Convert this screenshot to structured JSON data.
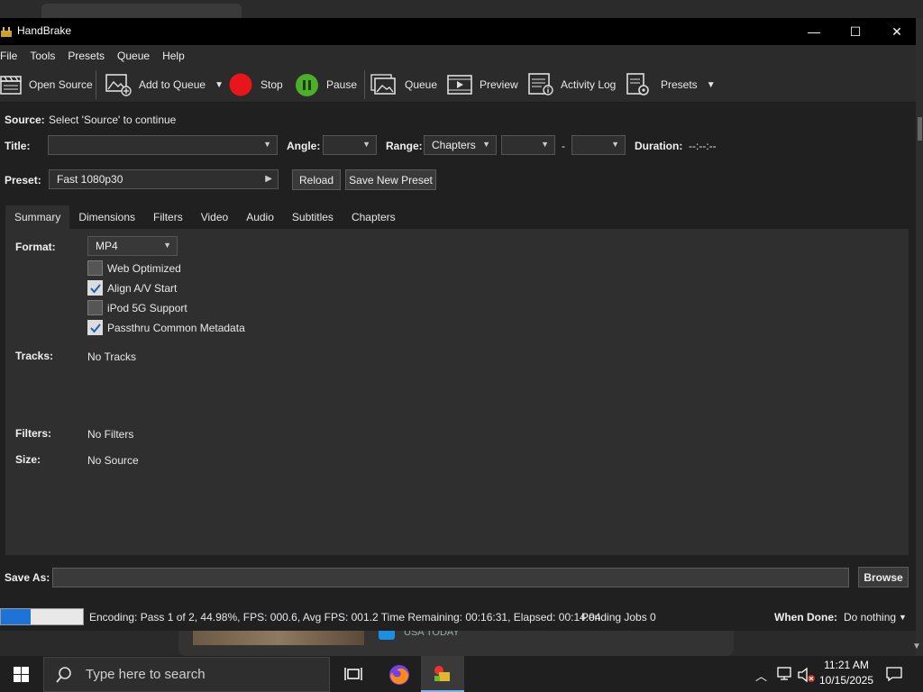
{
  "window": {
    "title": "HandBrake"
  },
  "menu": [
    "File",
    "Tools",
    "Presets",
    "Queue",
    "Help"
  ],
  "toolbar": {
    "open_source": "Open Source",
    "add_to_queue": "Add to Queue",
    "stop": "Stop",
    "pause": "Pause",
    "queue": "Queue",
    "preview": "Preview",
    "activity_log": "Activity Log",
    "presets": "Presets"
  },
  "source": {
    "label": "Source:",
    "value": "Select 'Source' to continue"
  },
  "title_row": {
    "title_label": "Title:",
    "angle_label": "Angle:",
    "range_label": "Range:",
    "range_value": "Chapters",
    "dash": "-",
    "duration_label": "Duration:",
    "duration_value": "--:--:--"
  },
  "preset_row": {
    "label": "Preset:",
    "value": "Fast 1080p30",
    "reload": "Reload",
    "save_new": "Save New Preset"
  },
  "tabs": [
    "Summary",
    "Dimensions",
    "Filters",
    "Video",
    "Audio",
    "Subtitles",
    "Chapters"
  ],
  "summary": {
    "format_label": "Format:",
    "format_value": "MP4",
    "options": [
      {
        "label": "Web Optimized",
        "checked": false
      },
      {
        "label": "Align A/V Start",
        "checked": true
      },
      {
        "label": "iPod 5G Support",
        "checked": false
      },
      {
        "label": "Passthru Common Metadata",
        "checked": true
      }
    ],
    "tracks_label": "Tracks:",
    "tracks_value": "No Tracks",
    "filters_label": "Filters:",
    "filters_value": "No Filters",
    "size_label": "Size:",
    "size_value": "No Source"
  },
  "save_as": {
    "label": "Save As:",
    "value": "",
    "browse": "Browse"
  },
  "status": {
    "progress_percent": 44.98,
    "encoding_text": "Encoding: Pass 1 of 2,  44.98%, FPS: 000.6,  Avg FPS: 001.2 Time Remaining: 00:16:31,  Elapsed: 00:14:04",
    "pending": "Pending Jobs 0",
    "when_done_label": "When Done:",
    "when_done_value": "Do nothing"
  },
  "background": {
    "card_text": "USA TODAY"
  },
  "taskbar": {
    "search_placeholder": "Type here to search",
    "time": "11:21 AM",
    "date": "10/15/2025"
  },
  "colors": {
    "accent": "#1e73d8",
    "stop_red": "#e8161b",
    "pause_green": "#4caf2a"
  }
}
